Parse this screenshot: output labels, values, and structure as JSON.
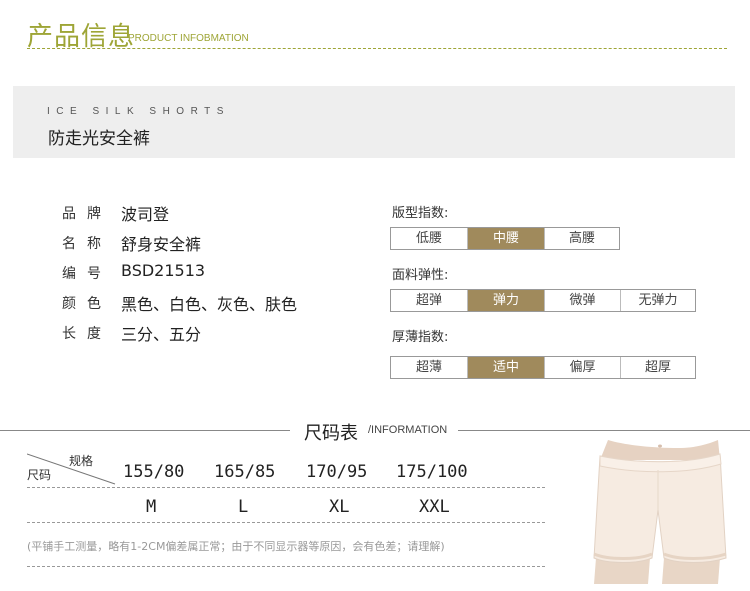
{
  "header": {
    "title_cn": "产品信息",
    "title_en": "PRODUCT INFOBMATION"
  },
  "banner": {
    "title_en": "ICE SILK SHORTS",
    "title_cn": "防走光安全裤"
  },
  "specs": [
    {
      "label": "品牌",
      "value": "波司登"
    },
    {
      "label": "名称",
      "value": "舒身安全裤"
    },
    {
      "label": "编号",
      "value": "BSD21513"
    },
    {
      "label": "颜色",
      "value": "黑色、白色、灰色、肤色"
    },
    {
      "label": "长度",
      "value": "三分、五分"
    }
  ],
  "indices": [
    {
      "title": "版型指数:",
      "options": [
        "低腰",
        "中腰",
        "高腰"
      ],
      "selected": "中腰"
    },
    {
      "title": "面料弹性:",
      "options": [
        "超弹",
        "弹力",
        "微弹",
        "无弹力"
      ],
      "selected": "弹力"
    },
    {
      "title": "厚薄指数:",
      "options": [
        "超薄",
        "适中",
        "偏厚",
        "超厚"
      ],
      "selected": "适中"
    }
  ],
  "size_table": {
    "title_cn": "尺码表",
    "title_en": "/INFORMATION",
    "header_spec": "规格",
    "header_code": "尺码",
    "specs": [
      "155/80",
      "165/85",
      "170/95",
      "175/100"
    ],
    "codes": [
      "M",
      "L",
      "XL",
      "XXL"
    ],
    "note": "(平铺手工测量，略有1-2CM偏差属正常；由于不同显示器等原因，会有色差；请理解)"
  },
  "colors": {
    "accent": "#9ea536",
    "selected": "#a08a5c",
    "banner_bg": "#eeeeee"
  }
}
